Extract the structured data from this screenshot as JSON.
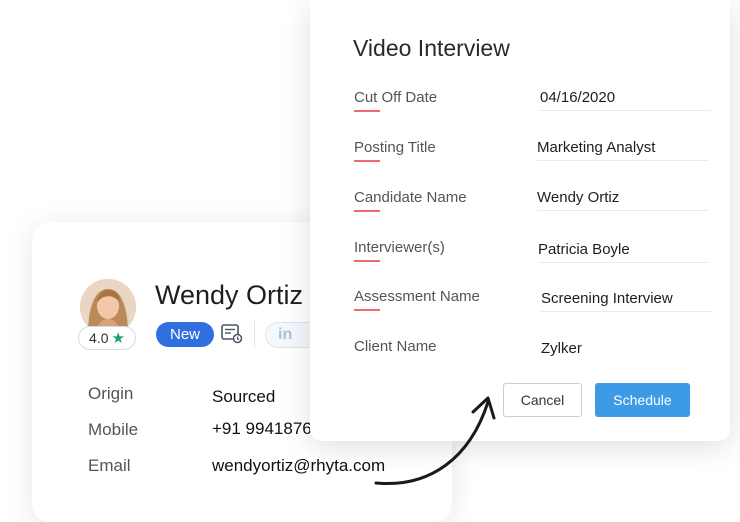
{
  "candidate": {
    "name": "Wendy Ortiz",
    "rating": "4.0",
    "status_badge": "New",
    "linkedin_label": "in",
    "fields": [
      {
        "label": "Origin",
        "value": "Sourced"
      },
      {
        "label": "Mobile",
        "value": "+91 9941876"
      },
      {
        "label": "Email",
        "value": "wendyortiz@rhyta.com"
      }
    ]
  },
  "modal": {
    "title": "Video Interview",
    "fields": [
      {
        "label": "Cut Off Date",
        "value": "04/16/2020"
      },
      {
        "label": "Posting Title",
        "value": "Marketing Analyst"
      },
      {
        "label": "Candidate Name",
        "value": "Wendy Ortiz"
      },
      {
        "label": "Interviewer(s)",
        "value": "Patricia Boyle"
      },
      {
        "label": "Assessment Name",
        "value": "Screening Interview"
      },
      {
        "label": "Client Name",
        "value": "Zylker"
      }
    ],
    "cancel_label": "Cancel",
    "schedule_label": "Schedule"
  },
  "colors": {
    "accent_red": "#ef6a6a",
    "primary_blue": "#3d9ae6",
    "badge_blue": "#2f6fe0",
    "star_green": "#1aa26c"
  }
}
